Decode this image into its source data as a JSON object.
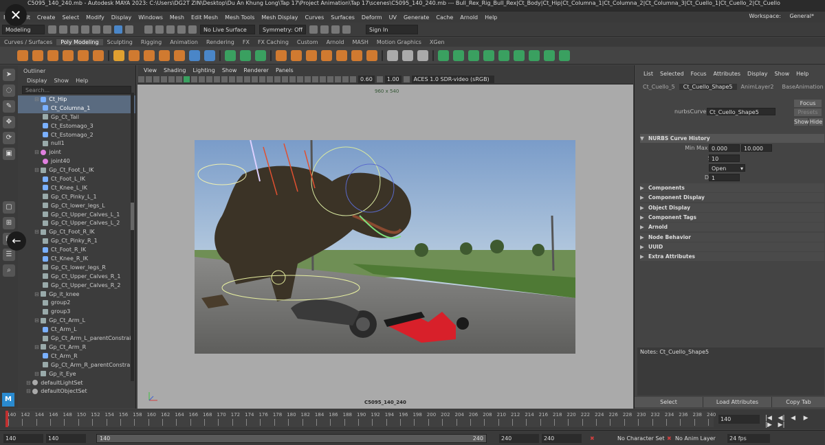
{
  "titlebar": {
    "text": "C5095_140_240.mb - Autodesk MAYA 2023: C:\\Users\\DG2T ZIN\\Desktop\\Du An Khung Long\\Tap 17\\Project Animation\\Tap 17\\scenes\\C5095_140_240.mb   ---   Bull_Rex_Rig_Bull_Rex|Ct_Body|Ct_Hip|Ct_Columna_1|Ct_Columna_2|Ct_Columna_3|Ct_Cuello_1|Ct_Cuello_2|Ct_Cuello"
  },
  "overlay": {
    "close_glyph": "✕",
    "back_glyph": "←"
  },
  "menubar": {
    "items": [
      "File",
      "Edit",
      "Create",
      "Select",
      "Modify",
      "Display",
      "Windows",
      "Mesh",
      "Edit Mesh",
      "Mesh Tools",
      "Mesh Display",
      "Curves",
      "Surfaces",
      "Deform",
      "UV",
      "Generate",
      "Cache",
      "Arnold",
      "Help"
    ],
    "workspace_label": "Workspace:",
    "workspace_value": "General*"
  },
  "statusline": {
    "mode": "Modeling",
    "live_surface": "No Live Surface",
    "symmetry": "Symmetry: Off",
    "sign_in": "Sign In"
  },
  "shelf": {
    "tabs": [
      "Curves / Surfaces",
      "Poly Modeling",
      "Sculpting",
      "Rigging",
      "Animation",
      "Rendering",
      "FX",
      "FX Caching",
      "Custom",
      "Arnold",
      "MASH",
      "Motion Graphics",
      "XGen"
    ],
    "active_tab": "Poly Modeling"
  },
  "outliner": {
    "title": "Outliner",
    "menu": [
      "Display",
      "Show",
      "Help"
    ],
    "search_placeholder": "Search...",
    "items": [
      {
        "label": "Ct_Hip",
        "indent": 1,
        "icon": "cv",
        "selected": true
      },
      {
        "label": "Ct_Columna_1",
        "indent": 2,
        "icon": "cv",
        "selected": true
      },
      {
        "label": "Gp_Ct_Tail",
        "indent": 2,
        "icon": "tr",
        "selected": false
      },
      {
        "label": "Ct_Estomago_3",
        "indent": 2,
        "icon": "cv",
        "selected": false
      },
      {
        "label": "Ct_Estomago_2",
        "indent": 2,
        "icon": "cv",
        "selected": false
      },
      {
        "label": "null1",
        "indent": 2,
        "icon": "tr",
        "selected": false
      },
      {
        "label": "joint",
        "indent": 1,
        "icon": "jt",
        "selected": false
      },
      {
        "label": "joint40",
        "indent": 2,
        "icon": "jt",
        "selected": false
      },
      {
        "label": "Gp_Ct_Foot_L_IK",
        "indent": 1,
        "icon": "tr",
        "selected": false
      },
      {
        "label": "Ct_Foot_L_IK",
        "indent": 2,
        "icon": "cv",
        "selected": false
      },
      {
        "label": "Ct_Knee_L_IK",
        "indent": 2,
        "icon": "cv",
        "selected": false
      },
      {
        "label": "Gp_Ct_Pinky_L_1",
        "indent": 2,
        "icon": "tr",
        "selected": false
      },
      {
        "label": "Gp_Ct_lower_legs_L",
        "indent": 2,
        "icon": "tr",
        "selected": false
      },
      {
        "label": "Gp_Ct_Upper_Calves_L_1",
        "indent": 2,
        "icon": "tr",
        "selected": false
      },
      {
        "label": "Gp_Ct_Upper_Calves_L_2",
        "indent": 2,
        "icon": "tr",
        "selected": false
      },
      {
        "label": "Gp_Ct_Foot_R_IK",
        "indent": 1,
        "icon": "tr",
        "selected": false
      },
      {
        "label": "Gp_Ct_Pinky_R_1",
        "indent": 2,
        "icon": "tr",
        "selected": false
      },
      {
        "label": "Ct_Foot_R_IK",
        "indent": 2,
        "icon": "cv",
        "selected": false
      },
      {
        "label": "Ct_Knee_R_IK",
        "indent": 2,
        "icon": "cv",
        "selected": false
      },
      {
        "label": "Gp_Ct_lower_legs_R",
        "indent": 2,
        "icon": "tr",
        "selected": false
      },
      {
        "label": "Gp_Ct_Upper_Calves_R_1",
        "indent": 2,
        "icon": "tr",
        "selected": false
      },
      {
        "label": "Gp_Ct_Upper_Calves_R_2",
        "indent": 2,
        "icon": "tr",
        "selected": false
      },
      {
        "label": "Gp_it_knee",
        "indent": 1,
        "icon": "tr",
        "selected": false
      },
      {
        "label": "group2",
        "indent": 2,
        "icon": "tr",
        "selected": false
      },
      {
        "label": "group3",
        "indent": 2,
        "icon": "tr",
        "selected": false
      },
      {
        "label": "Gp_Ct_Arm_L",
        "indent": 1,
        "icon": "tr",
        "selected": false
      },
      {
        "label": "Ct_Arm_L",
        "indent": 2,
        "icon": "cv",
        "selected": false
      },
      {
        "label": "Gp_Ct_Arm_L_parentConstrain",
        "indent": 2,
        "icon": "tr",
        "selected": false
      },
      {
        "label": "Gp_Ct_Arm_R",
        "indent": 1,
        "icon": "tr",
        "selected": false
      },
      {
        "label": "Ct_Arm_R",
        "indent": 2,
        "icon": "cv",
        "selected": false
      },
      {
        "label": "Gp_Ct_Arm_R_parentConstrai",
        "indent": 2,
        "icon": "tr",
        "selected": false
      },
      {
        "label": "Gp_it_Eye",
        "indent": 1,
        "icon": "tr",
        "selected": false
      },
      {
        "label": "defaultLightSet",
        "indent": 0,
        "icon": "set",
        "selected": false
      },
      {
        "label": "defaultObjectSet",
        "indent": 0,
        "icon": "set",
        "selected": false
      }
    ]
  },
  "toolbox": {
    "logo": "M"
  },
  "viewport": {
    "menu": [
      "View",
      "Shading",
      "Lighting",
      "Show",
      "Renderer",
      "Panels"
    ],
    "exposure": "0.60",
    "gamma": "1.00",
    "color_space": "ACES 1.0 SDR-video (sRGB)",
    "resolution": "960 x 540",
    "camera": "C5095_140_240"
  },
  "attribute_editor": {
    "menu": [
      "List",
      "Selected",
      "Focus",
      "Attributes",
      "Display",
      "Show",
      "Help"
    ],
    "tabs": [
      "Ct_Cuello_5",
      "Ct_Cuello_Shape5",
      "AnimLayer2",
      "BaseAnimation",
      "B_Re"
    ],
    "active_tab": "Ct_Cuello_Shape5",
    "node_type_label": "nurbsCurve:",
    "node_name": "Ct_Cuello_Shape5",
    "buttons": {
      "focus": "Focus",
      "presets": "Presets",
      "show": "Show",
      "hide": "Hide"
    },
    "history_section": "NURBS Curve History",
    "min_max_label": "Min Max Value",
    "min_value": "0.000",
    "max_value": "10.000",
    "spans_label": "Spans",
    "spans_value": "10",
    "form_label": "Form",
    "form_value": "Open",
    "degree_label": "Degree",
    "degree_value": "1",
    "sections": [
      "Components",
      "Component Display",
      "Object Display",
      "Component Tags",
      "Arnold",
      "Node Behavior",
      "UUID",
      "Extra Attributes"
    ],
    "notes_label": "Notes: Ct_Cuello_Shape5",
    "bottom_buttons": [
      "Select",
      "Load Attributes",
      "Copy Tab"
    ]
  },
  "timeslider": {
    "ticks": [
      "140",
      "142",
      "144",
      "146",
      "148",
      "150",
      "152",
      "154",
      "156",
      "158",
      "160",
      "162",
      "164",
      "166",
      "168",
      "170",
      "172",
      "174",
      "176",
      "178",
      "180",
      "182",
      "184",
      "186",
      "188",
      "190",
      "192",
      "194",
      "196",
      "198",
      "200",
      "202",
      "204",
      "206",
      "208",
      "210",
      "212",
      "214",
      "216",
      "218",
      "220",
      "222",
      "224",
      "226",
      "228",
      "230",
      "232",
      "234",
      "236",
      "238",
      "240"
    ],
    "current_frame": "140"
  },
  "rangeslider": {
    "start": "140",
    "playback_start": "140",
    "range_start": "140",
    "range_end": "240",
    "playback_end": "240",
    "end": "240",
    "character_set": "No Character Set",
    "anim_layer": "No Anim Layer",
    "fps": "24 fps"
  }
}
